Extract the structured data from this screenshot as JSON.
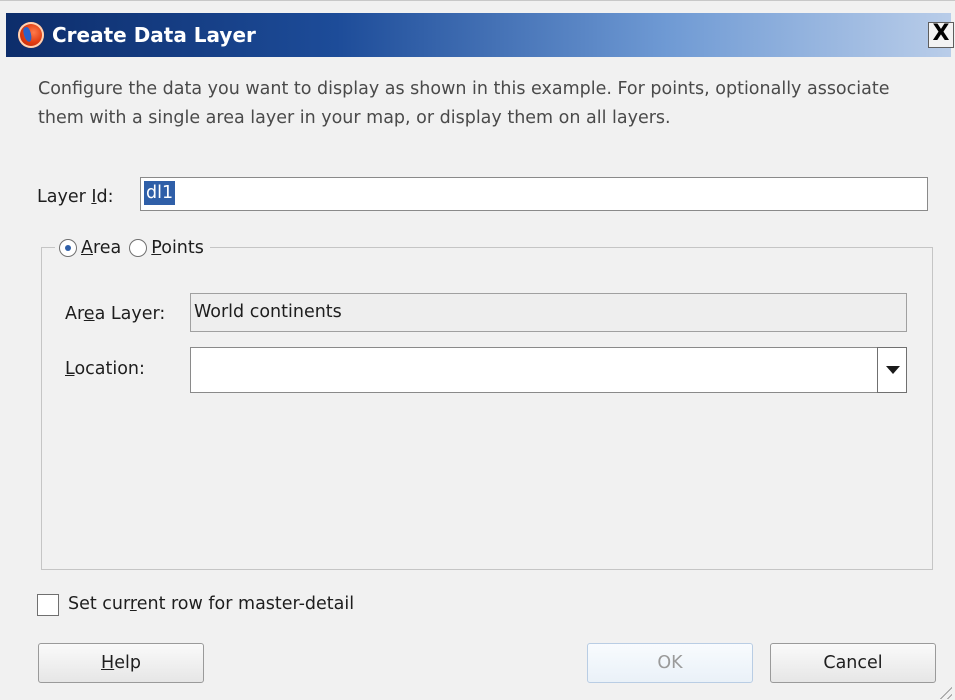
{
  "window": {
    "title": "Create Data Layer",
    "close_label": "X"
  },
  "description": "Configure the data you want to display as shown in this example. For points, optionally associate them with a single area layer in your map, or display them on all layers.",
  "layer_id": {
    "label_pre": "Layer ",
    "label_mnemonic": "I",
    "label_post": "d:",
    "value": "dl1"
  },
  "mode": {
    "area": {
      "mnemonic": "A",
      "rest": "rea",
      "checked": true
    },
    "points": {
      "mnemonic": "P",
      "rest": "oints",
      "checked": false
    }
  },
  "area_layer": {
    "label_pre": "Ar",
    "label_mnemonic": "e",
    "label_post": "a Layer:",
    "value": "World continents"
  },
  "location": {
    "label_mnemonic": "L",
    "label_post": "ocation:",
    "value": ""
  },
  "master_detail": {
    "label_pre": "Set cur",
    "label_mnemonic": "r",
    "label_post": "ent row for master-detail",
    "checked": false
  },
  "buttons": {
    "help": {
      "mnemonic": "H",
      "rest": "elp"
    },
    "ok": "OK",
    "cancel": "Cancel"
  }
}
